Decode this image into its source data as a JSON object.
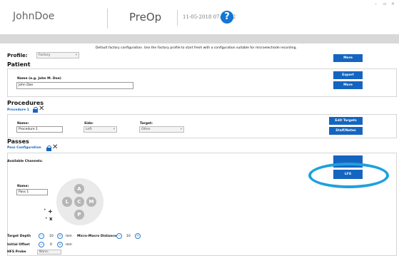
{
  "window": {
    "minimize": "–",
    "maximize": "▫",
    "close": "×"
  },
  "header": {
    "user": "JohnDoe",
    "mode": "PreOp",
    "datetime": "11-05-2018 07:59:22",
    "help_glyph": "?"
  },
  "profile": {
    "label": "Profile:",
    "value": "Factory",
    "description": "Default factory configuration. Use the Factory profile to start fresh with a configuration suitable for microelectrode recording.",
    "more_label": "More"
  },
  "patient": {
    "title": "Patient",
    "name_label": "Name (e.g. John M. Doe)",
    "name_value": "John Doe",
    "export_label": "Export",
    "more_label": "More"
  },
  "procedures": {
    "title": "Procedures",
    "procedure_tab": "Procedure 1",
    "name_label": "Name:",
    "name_value": "Procedure 1",
    "side_label": "Side:",
    "side_value": "Left",
    "target_label": "Target:",
    "target_value": "Other",
    "edit_targets_label": "Edit Targets",
    "staff_label": "Staff/Notes"
  },
  "passes": {
    "title": "Passes",
    "config_tab": "Pass Configuration",
    "available_channels_label": "Available Channels:",
    "name_label": "Name:",
    "name_value": "Pass 1",
    "lfs_label": "LFS",
    "dpad": {
      "up": "A",
      "left": "L",
      "center": "C",
      "right": "M",
      "down": "P"
    },
    "plus_label": "+",
    "x_label": "x",
    "target_depth": {
      "label": "Target Depth",
      "value": "10",
      "unit": "mm"
    },
    "micro_macro": {
      "label": "Micro-Macro Distance",
      "value": "10"
    },
    "initial_offset": {
      "label": "Initial Offset",
      "value": "0",
      "unit": "mm"
    },
    "bottom_label": "HFS Probe",
    "bottom_value": "Nano.."
  },
  "colors": {
    "accent": "#1565c0",
    "highlight_circle": "#1fa0dd"
  }
}
